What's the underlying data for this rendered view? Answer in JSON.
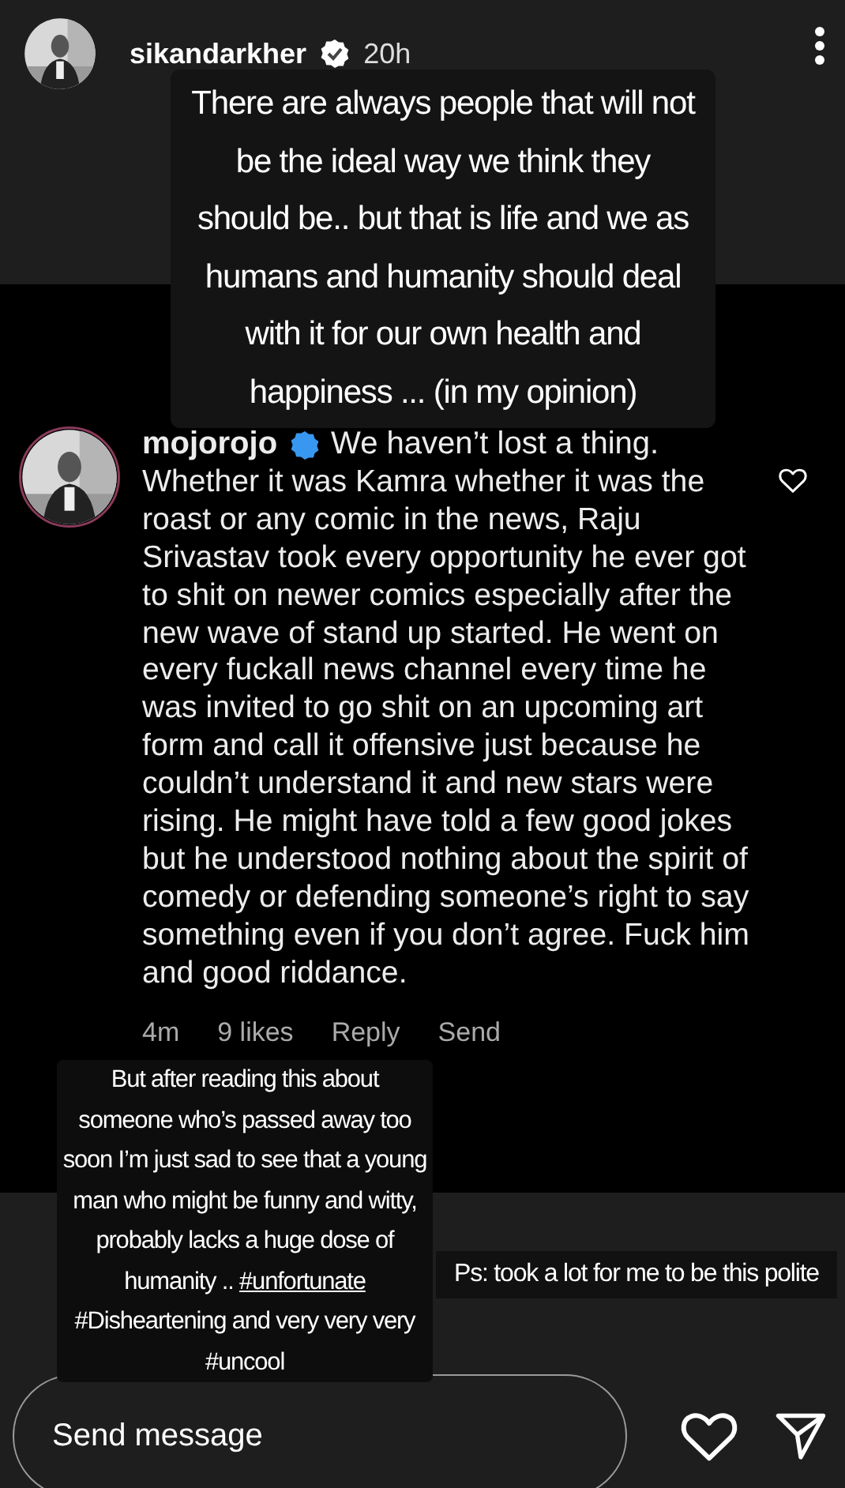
{
  "story_header": {
    "username": "sikandarkher",
    "verified": true,
    "time": "20h"
  },
  "stickers": [
    {
      "kind": "caption",
      "segments": [
        {
          "kind": "text",
          "text": "There are always people that will not be the ideal way we think they should be.. but that is life and we as humans and humanity should deal with it for our own health and happiness ... (in my opinion)"
        }
      ]
    },
    {
      "kind": "caption",
      "segments": [
        {
          "kind": "text",
          "text": "But after reading this about someone who’s passed away too soon I’m just sad to see that a young man who might be funny and witty, probably lacks a huge dose of humanity .."
        },
        {
          "kind": "hashtag",
          "text": "#unfortunate",
          "underlined": true
        },
        {
          "kind": "hashtag",
          "text": "#Disheartening",
          "underlined": false
        },
        {
          "kind": "text",
          "text": "and very very very"
        },
        {
          "kind": "hashtag",
          "text": "#uncool",
          "underlined": false
        }
      ]
    },
    {
      "kind": "caption",
      "segments": [
        {
          "kind": "text",
          "text": "Ps: took a lot for me to be this polite"
        }
      ]
    }
  ],
  "comment": {
    "username": "mojorojo",
    "verified": true,
    "text_lead": "We haven’t lost a thing.",
    "text": "Whether it was Kamra whether it was the roast or any comic in the news, Raju Srivastav took every opportunity he ever got to shit on newer comics especially after the new wave of stand up started. He went on every fuckall news channel every time he was invited to go shit on an upcoming art form and call it offensive just because he couldn’t understand it and new stars were rising. He might have told a few good jokes but he understood nothing about the spirit of comedy or defending someone’s right to say something even if you don’t agree. Fuck him and good riddance.",
    "time": "4m",
    "likes": "9 likes",
    "actions": [
      "Reply",
      "Send"
    ],
    "liked": false
  },
  "message_bar": {
    "placeholder": "Send message",
    "liked": false
  }
}
